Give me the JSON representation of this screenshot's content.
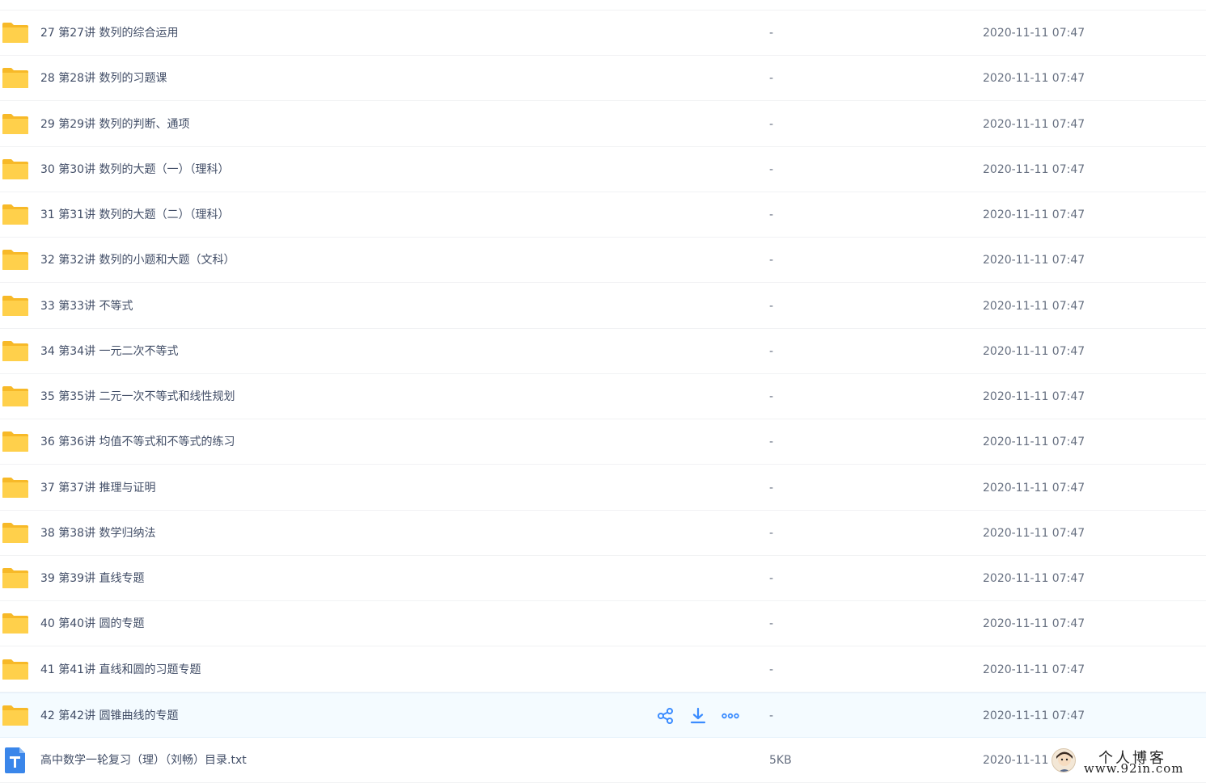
{
  "colors": {
    "folder": "#ffd04b",
    "folder_back": "#f7b928",
    "accent": "#3b8cff",
    "txt_icon": "#3a86ea",
    "hover_bg": "#f4fbff"
  },
  "files": [
    {
      "name": "27 第27讲 数列的综合运用",
      "size": "-",
      "time": "2020-11-11 07:47",
      "type": "folder-icon"
    },
    {
      "name": "28 第28讲 数列的习题课",
      "size": "-",
      "time": "2020-11-11 07:47",
      "type": "folder-icon"
    },
    {
      "name": "29 第29讲 数列的判断、通项",
      "size": "-",
      "time": "2020-11-11 07:47",
      "type": "folder-icon"
    },
    {
      "name": "30 第30讲 数列的大题（一）（理科）",
      "size": "-",
      "time": "2020-11-11 07:47",
      "type": "folder-icon"
    },
    {
      "name": "31 第31讲 数列的大题（二）（理科）",
      "size": "-",
      "time": "2020-11-11 07:47",
      "type": "folder-icon"
    },
    {
      "name": "32 第32讲 数列的小题和大题（文科）",
      "size": "-",
      "time": "2020-11-11 07:47",
      "type": "folder-icon"
    },
    {
      "name": "33 第33讲 不等式",
      "size": "-",
      "time": "2020-11-11 07:47",
      "type": "folder-icon"
    },
    {
      "name": "34 第34讲 一元二次不等式",
      "size": "-",
      "time": "2020-11-11 07:47",
      "type": "folder-icon"
    },
    {
      "name": "35 第35讲 二元一次不等式和线性规划",
      "size": "-",
      "time": "2020-11-11 07:47",
      "type": "folder-icon"
    },
    {
      "name": "36 第36讲 均值不等式和不等式的练习",
      "size": "-",
      "time": "2020-11-11 07:47",
      "type": "folder-icon"
    },
    {
      "name": "37 第37讲 推理与证明",
      "size": "-",
      "time": "2020-11-11 07:47",
      "type": "folder-icon"
    },
    {
      "name": "38 第38讲 数学归纳法",
      "size": "-",
      "time": "2020-11-11 07:47",
      "type": "folder-icon"
    },
    {
      "name": "39 第39讲 直线专题",
      "size": "-",
      "time": "2020-11-11 07:47",
      "type": "folder-icon"
    },
    {
      "name": "40 第40讲 圆的专题",
      "size": "-",
      "time": "2020-11-11 07:47",
      "type": "folder-icon"
    },
    {
      "name": "41 第41讲 直线和圆的习题专题",
      "size": "-",
      "time": "2020-11-11 07:47",
      "type": "folder-icon"
    },
    {
      "name": "42 第42讲 圆锥曲线的专题",
      "size": "-",
      "time": "2020-11-11 07:47",
      "type": "folder-icon",
      "hovered": true
    },
    {
      "name": "高中数学一轮复习（理）（刘畅）目录.txt",
      "size": "5KB",
      "time": "2020-11-11",
      "type": "txt-file-icon"
    }
  ],
  "row_actions": [
    "share-icon",
    "download-icon",
    "more-icon"
  ],
  "watermark": {
    "title": "个人博客",
    "url": "www.92in.com"
  }
}
